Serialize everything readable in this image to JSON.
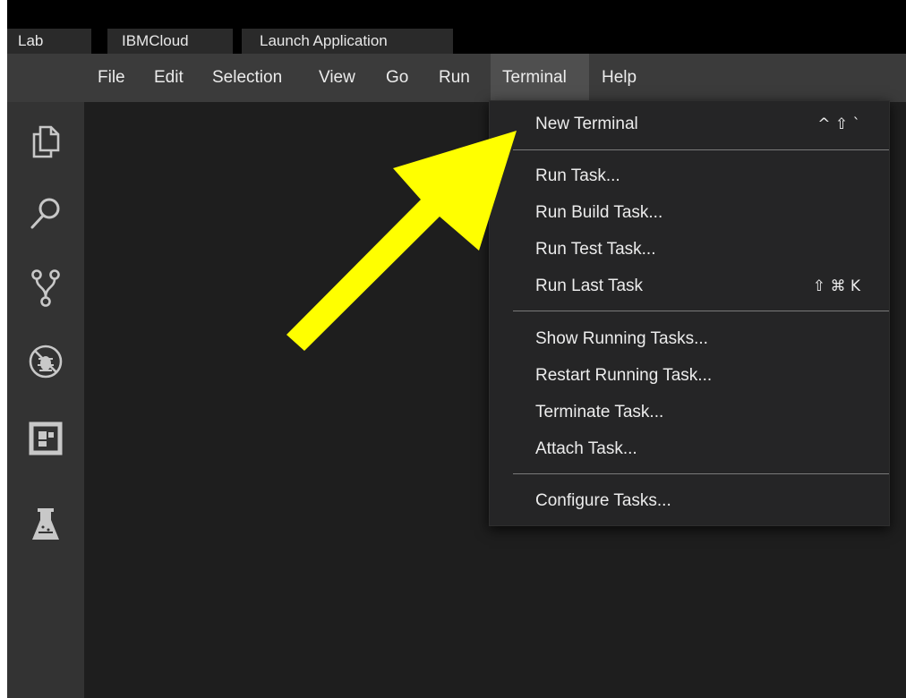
{
  "tabs": [
    "Lab",
    "IBMCloud",
    "Launch Application"
  ],
  "menubar": [
    "File",
    "Edit",
    "Selection",
    "View",
    "Go",
    "Run",
    "Terminal",
    "Help"
  ],
  "activity_bar": [
    "explorer-icon",
    "search-icon",
    "source-control-icon",
    "debug-icon",
    "extensions-icon",
    "lab-flask-icon"
  ],
  "terminal_menu": {
    "new_terminal": {
      "label": "New Terminal",
      "shortcut": "^ ⇧ `"
    },
    "run_task": "Run Task...",
    "run_build_task": "Run Build Task...",
    "run_test_task": "Run Test Task...",
    "run_last_task": {
      "label": "Run Last Task",
      "shortcut": "⇧ ⌘ K"
    },
    "show_running_tasks": "Show Running Tasks...",
    "restart_running_task": "Restart Running Task...",
    "terminate_task": "Terminate Task...",
    "attach_task": "Attach Task...",
    "configure_tasks": "Configure Tasks..."
  },
  "colors": {
    "editor_bg": "#1e1e1e",
    "menubar_bg": "#3b3b3b",
    "activity_bg": "#333333",
    "dropdown_bg": "#252526",
    "annotation_arrow": "#ffff00"
  }
}
